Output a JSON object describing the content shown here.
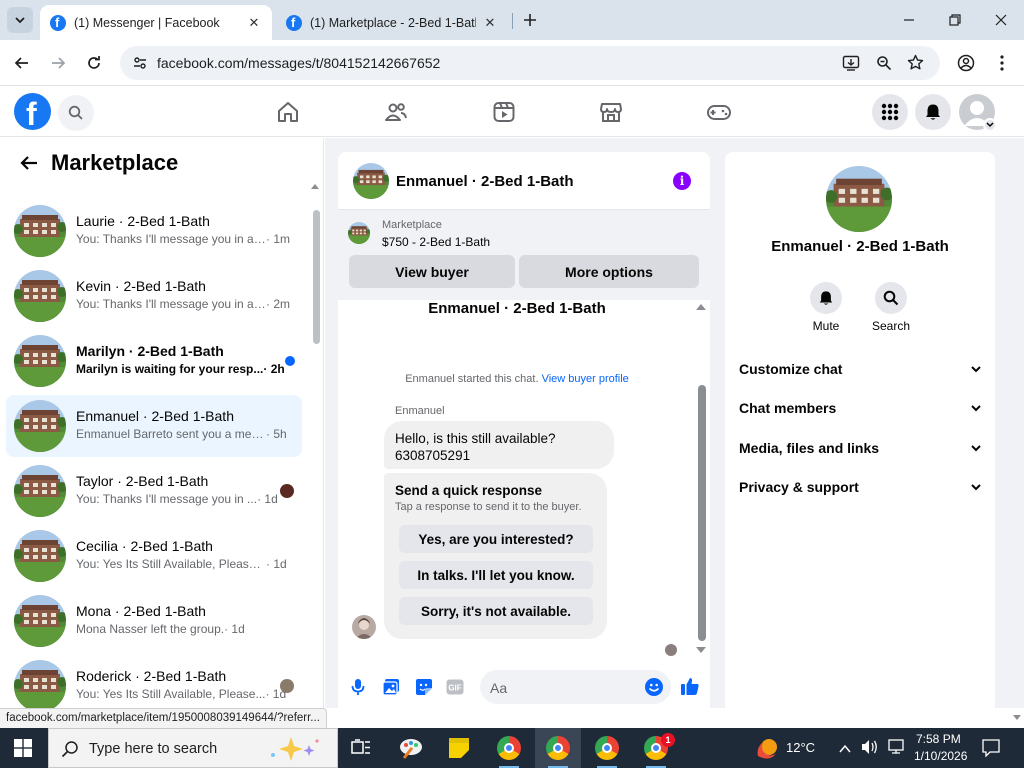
{
  "browser": {
    "tabs": [
      {
        "title": "(1) Messenger | Facebook",
        "active": true
      },
      {
        "title": "(1) Marketplace - 2-Bed 1-Bath",
        "active": false
      }
    ],
    "url": "facebook.com/messages/t/804152142667652"
  },
  "fb_header": {
    "nav_icons": [
      "home-icon",
      "friends-icon",
      "watch-icon",
      "marketplace-icon",
      "gaming-icon"
    ],
    "right_icons": [
      "menu-grid-icon",
      "notifications-bell-icon",
      "profile-avatar-icon"
    ]
  },
  "sidebar": {
    "title": "Marketplace",
    "conversations": [
      {
        "name": "Laurie · 2-Bed 1-Bath",
        "preview": "You: Thanks I'll message you in a ...",
        "time": "· 1m",
        "bold": false,
        "unread": false,
        "seen_avatar": false
      },
      {
        "name": "Kevin · 2-Bed 1-Bath",
        "preview": "You: Thanks I'll message you in a ...",
        "time": "· 2m",
        "bold": false,
        "unread": false,
        "seen_avatar": false
      },
      {
        "name": "Marilyn · 2-Bed 1-Bath",
        "preview": "Marilyn is waiting for your resp...",
        "time": "· 2h",
        "bold": true,
        "unread": true,
        "seen_avatar": false
      },
      {
        "name": "Enmanuel · 2-Bed 1-Bath",
        "preview": "Enmanuel Barreto sent you a mess...",
        "time": "· 5h",
        "bold": false,
        "unread": false,
        "seen_avatar": false,
        "active": true
      },
      {
        "name": "Taylor · 2-Bed 1-Bath",
        "preview": "You: Thanks I'll message you in ...",
        "time": "· 1d",
        "bold": false,
        "unread": false,
        "seen_avatar": true
      },
      {
        "name": "Cecilia · 2-Bed 1-Bath",
        "preview": "You: Yes Its Still Available, Please Se...",
        "time": "· 1d",
        "bold": false,
        "unread": false,
        "seen_avatar": false
      },
      {
        "name": "Mona · 2-Bed 1-Bath",
        "preview": "Mona Nasser left the group.",
        "time": "· 1d",
        "bold": false,
        "unread": false,
        "seen_avatar": false
      },
      {
        "name": "Roderick · 2-Bed 1-Bath",
        "preview": "You: Yes Its Still Available, Please...",
        "time": "· 1d",
        "bold": false,
        "unread": false,
        "seen_avatar": true
      }
    ]
  },
  "chat": {
    "title": "Enmanuel · 2-Bed 1-Bath",
    "banner": {
      "label": "Marketplace",
      "price_line": "$750 - 2-Bed 1-Bath",
      "view_buyer": "View buyer",
      "more_options": "More options"
    },
    "thread_title": "Enmanuel · 2-Bed 1-Bath",
    "system_text": "Enmanuel started this chat.",
    "system_link": "View buyer profile",
    "sender": "Enmanuel",
    "message_line1": "Hello, is this still available?",
    "message_line2": "6308705291",
    "quick_response": {
      "title": "Send a quick response",
      "subtitle": "Tap a response to send it to the buyer.",
      "options": [
        "Yes, are you interested?",
        "In talks. I'll let you know.",
        "Sorry, it's not available."
      ]
    },
    "composer_placeholder": "Aa"
  },
  "info_panel": {
    "name": "Enmanuel · 2-Bed 1-Bath",
    "actions": [
      {
        "label": "Mute",
        "icon": "bell-icon"
      },
      {
        "label": "Search",
        "icon": "search-icon"
      }
    ],
    "sections": [
      "Customize chat",
      "Chat members",
      "Media, files and links",
      "Privacy & support"
    ]
  },
  "status_url": "facebook.com/marketplace/item/1950008039149644/?referr...",
  "taskbar": {
    "search_placeholder": "Type here to search",
    "chrome_badge": "1",
    "weather": "12°C",
    "time": "7:58 PM",
    "date": "1/10/2026"
  },
  "colors": {
    "fb_blue": "#1877f2",
    "messenger_blue": "#0866ff",
    "info_purple": "#8a00ff",
    "active_row": "#ebf5ff"
  }
}
